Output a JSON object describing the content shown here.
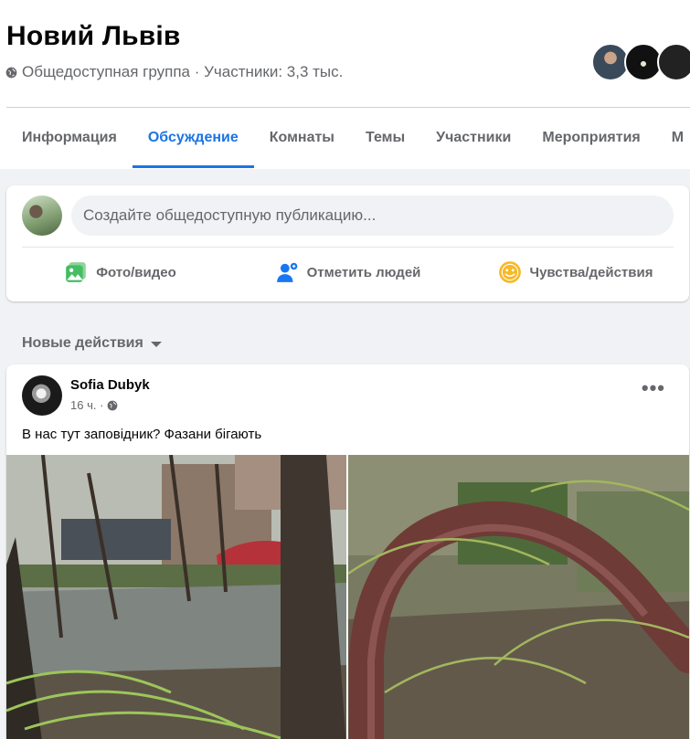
{
  "group": {
    "name": "Новий Львів",
    "meta": "Общедоступная группа · Участники: 3,3 тыс."
  },
  "tabs": [
    {
      "label": "Информация",
      "active": false
    },
    {
      "label": "Обсуждение",
      "active": true
    },
    {
      "label": "Комнаты",
      "active": false
    },
    {
      "label": "Темы",
      "active": false
    },
    {
      "label": "Участники",
      "active": false
    },
    {
      "label": "Мероприятия",
      "active": false
    },
    {
      "label": "М",
      "active": false
    }
  ],
  "composer": {
    "placeholder": "Создайте общедоступную публикацию...",
    "actions": [
      {
        "label": "Фото/видео",
        "icon": "photo-video-icon",
        "color": "#45bd62"
      },
      {
        "label": "Отметить людей",
        "icon": "tag-people-icon",
        "color": "#1877f2"
      },
      {
        "label": "Чувства/действия",
        "icon": "feeling-icon",
        "color": "#f7b928"
      }
    ]
  },
  "feed": {
    "sort_label": "Новые действия"
  },
  "post": {
    "author": "Sofia Dubyk",
    "time": "16 ч. ·",
    "more": "•••",
    "text": "В нас тут заповідник? Фазани бігають"
  },
  "colors": {
    "accent": "#1b74e4",
    "secondary_text": "#65676b",
    "background": "#f0f2f5"
  }
}
